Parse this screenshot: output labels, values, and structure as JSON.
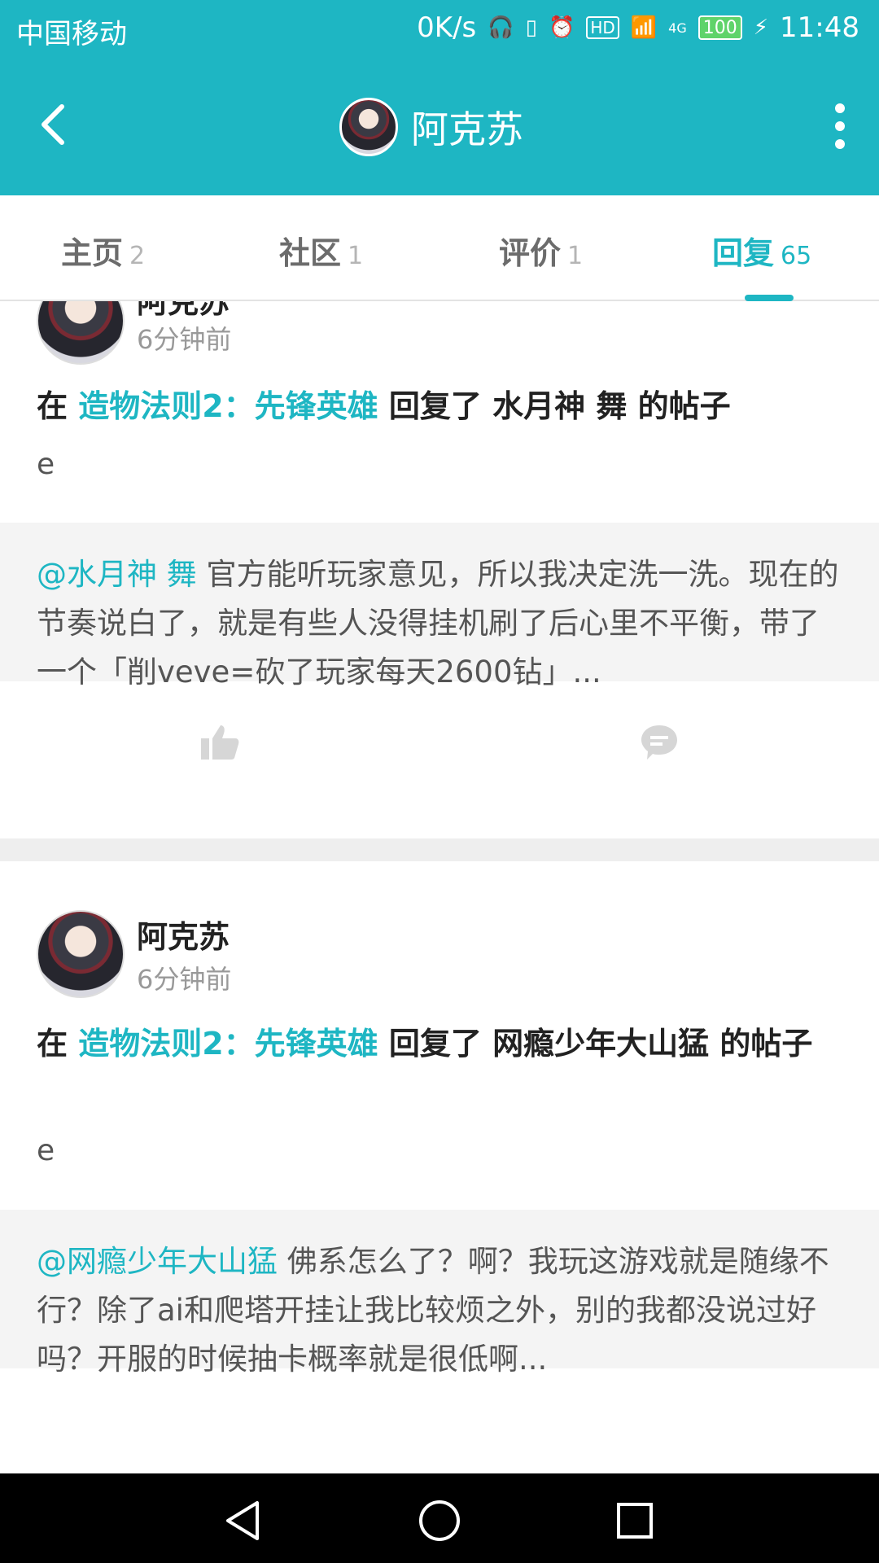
{
  "status_bar": {
    "carrier": "中国移动",
    "net_speed": "0K/s",
    "network": "4G",
    "battery": "100",
    "time": "11:48",
    "hd_badge": "HD"
  },
  "header": {
    "title": "阿克苏"
  },
  "tabs": [
    {
      "label": "主页",
      "count": "2"
    },
    {
      "label": "社区",
      "count": "1"
    },
    {
      "label": "评价",
      "count": "1"
    },
    {
      "label": "回复",
      "count": "65"
    }
  ],
  "posts": [
    {
      "username": "阿克苏",
      "time": "6分钟前",
      "prefix": "在 ",
      "game": "造物法则2：先锋英雄",
      "action": " 回复了 水月神 舞 的帖子",
      "reply": "e",
      "quote_at": "@水月神 舞",
      "quote_text": " 官方能听玩家意见，所以我决定洗一洗。现在的节奏说白了，就是有些人没得挂机刷了后心里不平衡，带了一个「削veve=砍了玩家每天2600钻」..."
    },
    {
      "username": "阿克苏",
      "time": "6分钟前",
      "prefix": "在 ",
      "game": "造物法则2：先锋英雄",
      "action": " 回复了 网瘾少年大山猛 的帖子",
      "reply": "e",
      "quote_at": "@网瘾少年大山猛",
      "quote_text": " 佛系怎么了？啊？我玩这游戏就是随缘不行？除了ai和爬塔开挂让我比较烦之外，别的我都没说过好吗？开服的时候抽卡概率就是很低啊..."
    }
  ],
  "icons": {
    "back": "back-arrow-icon",
    "more": "more-vertical-icon",
    "like": "thumbs-up-icon",
    "comment": "comment-icon"
  },
  "colors": {
    "accent": "#1eb6c3",
    "text": "#222222",
    "muted": "#999999"
  }
}
